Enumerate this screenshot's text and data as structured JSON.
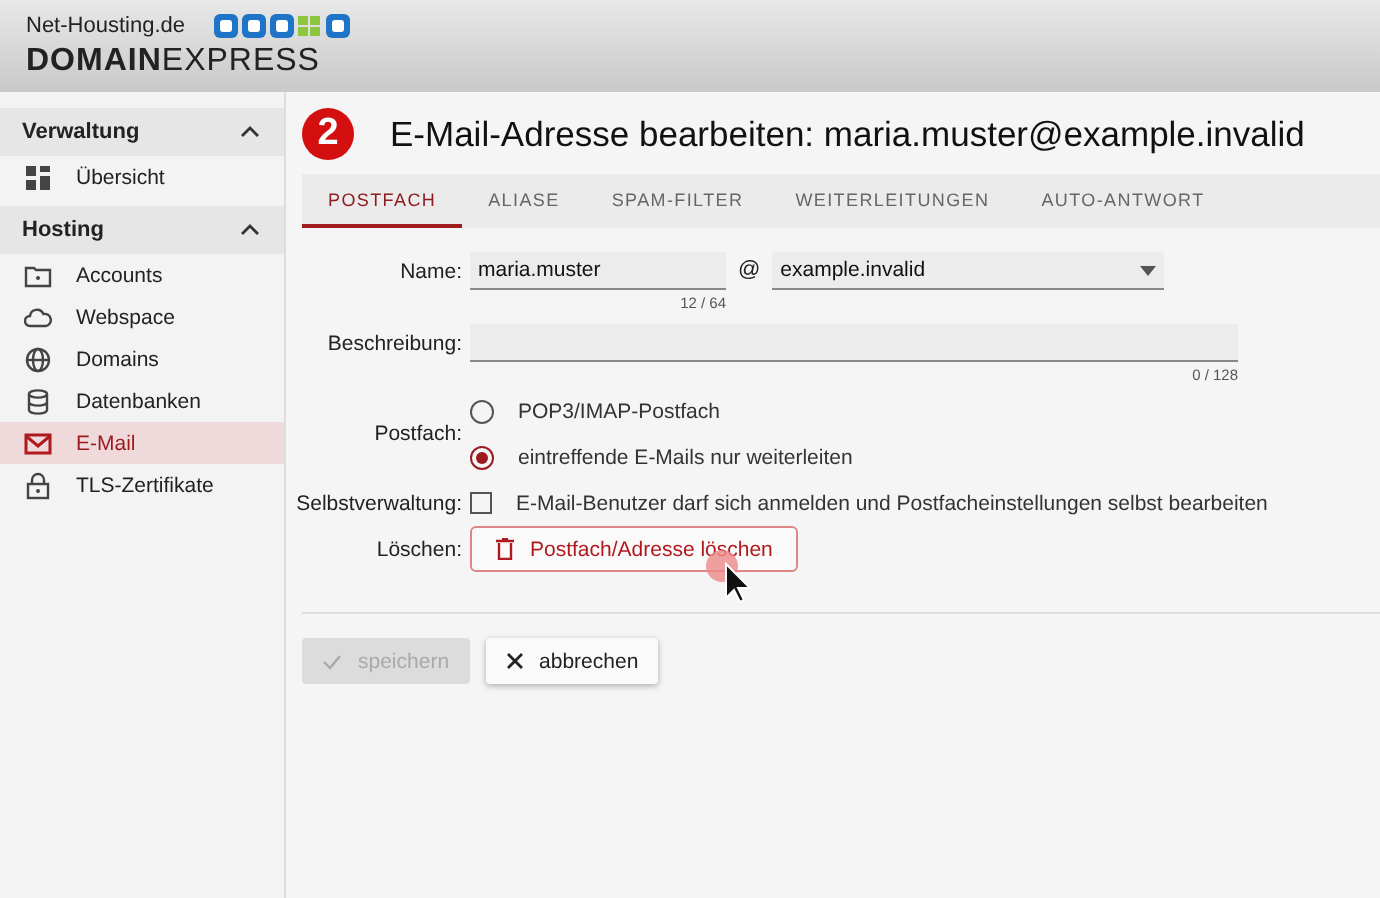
{
  "header": {
    "brand_top": "Net-Housting.de",
    "brand": "**DOMAIN**EXPRESS"
  },
  "sidebar": {
    "sections": [
      {
        "title": "Verwaltung",
        "expanded": true,
        "items": [
          {
            "label": "Übersicht",
            "selected": false
          }
        ]
      },
      {
        "title": "Hosting",
        "expanded": true,
        "items": [
          {
            "label": "Accounts",
            "selected": false
          },
          {
            "label": "Webspace",
            "selected": false
          },
          {
            "label": "Domains",
            "selected": false
          },
          {
            "label": "Datenbanken",
            "selected": false
          },
          {
            "label": "E-Mail",
            "selected": true
          },
          {
            "label": "TLS-Zertifikate",
            "selected": false
          }
        ]
      }
    ]
  },
  "step": "2",
  "title": "E-Mail-Adresse bearbeiten: maria.muster@example.invalid",
  "tabs": [
    {
      "label": "POSTFACH",
      "selected": true
    },
    {
      "label": "ALIASE",
      "selected": false
    },
    {
      "label": "SPAM-FILTER",
      "selected": false
    },
    {
      "label": "WEITERLEITUNGEN",
      "selected": false
    },
    {
      "label": "AUTO-ANTWORT",
      "selected": false
    }
  ],
  "form": {
    "name": {
      "label": "Name:",
      "value": "maria.muster",
      "counter": "12 / 64"
    },
    "at": "@",
    "domain": {
      "value": "example.invalid"
    },
    "description": {
      "label": "Beschreibung:",
      "counter": "0 / 128"
    },
    "mailbox": {
      "label": "Postfach:",
      "options": [
        {
          "label": "POP3/IMAP-Postfach",
          "selected": false
        },
        {
          "label": "eintreffende E-Mails nur weiterleiten",
          "selected": true
        }
      ]
    },
    "self_admin": {
      "label": "Selbstverwaltung:",
      "option": "E-Mail-Benutzer darf sich anmelden und Postfacheinstellungen selbst bearbeiten",
      "checked": false
    },
    "delete": {
      "label": "Löschen:",
      "button": "Postfach/Adresse löschen"
    }
  },
  "actions": [
    {
      "kind": "save",
      "label": "speichern",
      "disabled": true
    },
    {
      "kind": "cancel",
      "label": "abbrechen",
      "disabled": false
    }
  ]
}
